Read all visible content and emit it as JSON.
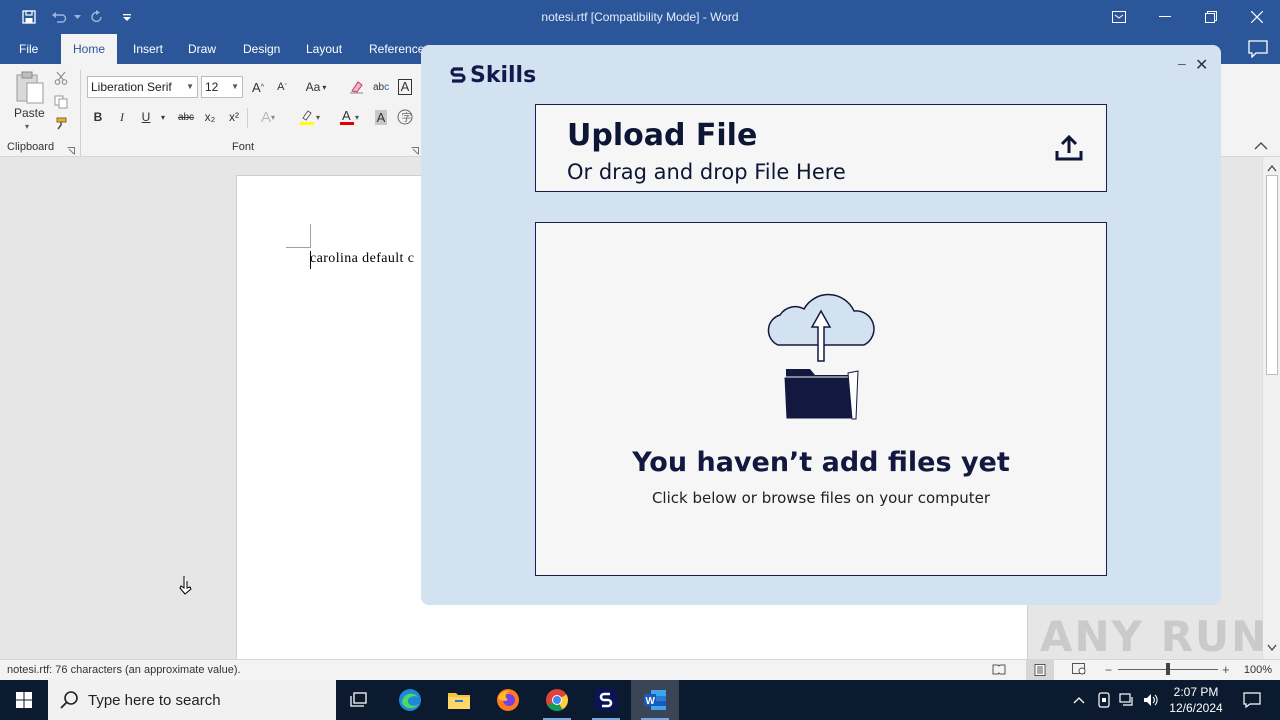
{
  "titlebar": {
    "document_title": "notesi.rtf [Compatibility Mode]  -  Word",
    "icons": [
      "save-icon",
      "undo-icon",
      "redo-icon",
      "customize-qat-icon",
      "ribbon-display-icon",
      "minimize-icon",
      "restore-icon",
      "close-icon"
    ]
  },
  "ribbon": {
    "tabs": [
      {
        "label": "File"
      },
      {
        "label": "Home"
      },
      {
        "label": "Insert"
      },
      {
        "label": "Draw"
      },
      {
        "label": "Design"
      },
      {
        "label": "Layout"
      },
      {
        "label": "Reference"
      }
    ],
    "active_tab": "Home",
    "clipboard": {
      "paste_label": "Paste",
      "group_label": "Clipboard"
    },
    "font": {
      "group_label": "Font",
      "font_name": "Liberation Serif",
      "font_size": "12",
      "change_case": "Aa",
      "bold": "B",
      "italic": "I",
      "underline": "U",
      "strike": "abc",
      "subscript": "x₂",
      "superscript": "x²"
    }
  },
  "document": {
    "text": "carolina default c"
  },
  "statusbar": {
    "text": "notesi.rtf: 76 characters (an approximate value).",
    "zoom": "100%"
  },
  "overlay": {
    "logo_text": "Skills",
    "upload_title": "Upload File",
    "upload_subtitle": "Or drag and drop File Here",
    "empty_title": "You haven’t add files yet",
    "empty_subtitle": "Click below or browse files on your computer",
    "minimize": "–",
    "close": "✕"
  },
  "watermark": "ANY RUN",
  "taskbar": {
    "search_placeholder": "Type here to search",
    "time": "2:07 PM",
    "date": "12/6/2024",
    "apps": [
      "task-view",
      "edge",
      "file-explorer",
      "firefox",
      "chrome",
      "skills",
      "word"
    ]
  },
  "colors": {
    "word_blue": "#2b579a",
    "overlay_bg": "#d3e2f1",
    "navy": "#12183f",
    "taskbar": "#0b1a2e"
  }
}
